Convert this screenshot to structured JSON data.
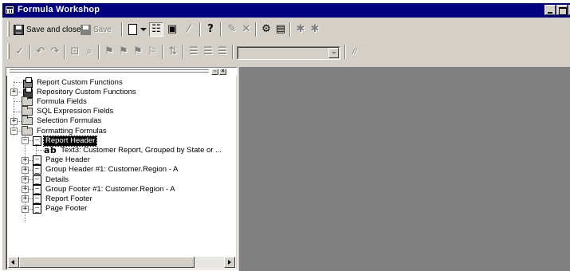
{
  "window": {
    "title": "Formula Workshop"
  },
  "toolbar_main": {
    "save_and_close_label": "Save and close",
    "save_label": "Save",
    "help_glyph": "?",
    "icons": [
      "save-and-close-icon",
      "save-icon",
      "new-icon",
      "dropdown-arrow-icon",
      "toggle-tree-icon",
      "toggle-properties-icon",
      "use-editor-icon",
      "help-icon",
      "rename-icon",
      "delete-icon",
      "expert-icon",
      "formula-editor-icon",
      "check-icon",
      "check-all-icon"
    ]
  },
  "toolbar_edit": {
    "comment_label": "//",
    "combo_value": "",
    "icons": [
      "check-formula-icon",
      "undo-icon",
      "redo-icon",
      "browse-data-icon",
      "find-replace-icon",
      "toggle-bookmark-icon",
      "next-bookmark-icon",
      "previous-bookmark-icon",
      "clear-bookmarks-icon",
      "sort-icon",
      "field-tree-icon",
      "function-tree-icon",
      "operator-tree-icon",
      "syntax-combo"
    ]
  },
  "tree": {
    "items": [
      {
        "label": "Report Custom Functions",
        "icon": "custom-function-icon",
        "expander": ""
      },
      {
        "label": "Repository Custom Functions",
        "icon": "repository-function-icon",
        "expander": "+"
      },
      {
        "label": "Formula Fields",
        "icon": "folder-icon",
        "expander": ""
      },
      {
        "label": "SQL Expression Fields",
        "icon": "folder-icon",
        "expander": ""
      },
      {
        "label": "Selection Formulas",
        "icon": "folder-icon",
        "expander": "+"
      },
      {
        "label": "Formatting Formulas",
        "icon": "folder-icon",
        "expander": "−"
      },
      {
        "label": "Report Header",
        "icon": "section-icon",
        "expander": "−",
        "selected": true
      },
      {
        "label": "Text3: Customer Report, Grouped by State or ...",
        "icon": "text-object-icon",
        "icon_text": "ab",
        "expander": ""
      },
      {
        "label": "Page Header",
        "icon": "section-icon",
        "expander": "+"
      },
      {
        "label": "Group Header #1: Customer.Region - A",
        "icon": "section-icon",
        "expander": "+"
      },
      {
        "label": "Details",
        "icon": "section-icon",
        "expander": "+"
      },
      {
        "label": "Group Footer #1: Customer.Region - A",
        "icon": "section-icon",
        "expander": "+"
      },
      {
        "label": "Report Footer",
        "icon": "section-icon",
        "expander": "+"
      },
      {
        "label": "Page Footer",
        "icon": "section-icon",
        "expander": "+"
      }
    ]
  },
  "colors": {
    "titlebar": "#000080",
    "face": "#d4d0c8",
    "workspace": "#808080",
    "selection": "#000000"
  }
}
